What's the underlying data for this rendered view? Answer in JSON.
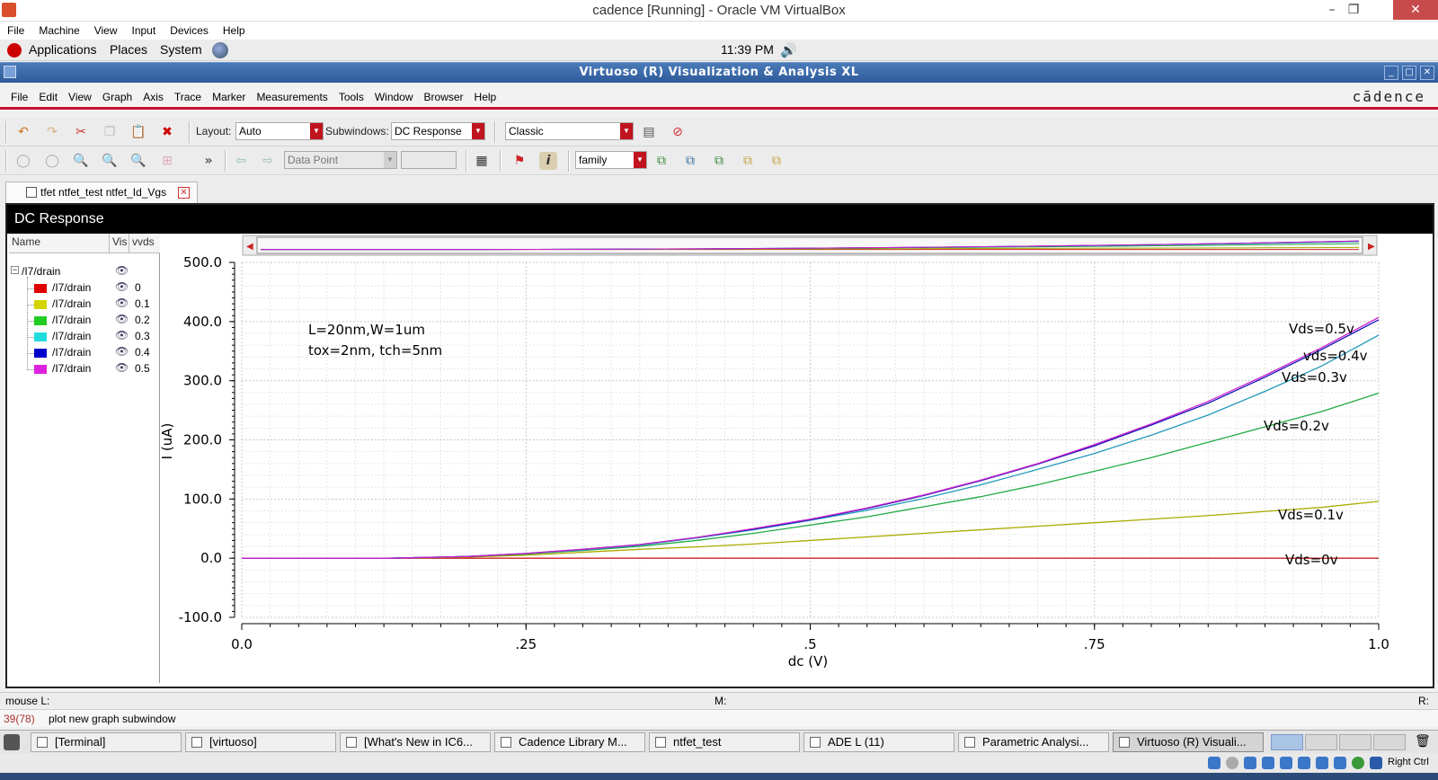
{
  "host_window": {
    "title": "cadence [Running] - Oracle VM VirtualBox",
    "menu": [
      "File",
      "Machine",
      "View",
      "Input",
      "Devices",
      "Help"
    ],
    "controls": [
      "–",
      "❐",
      "✕"
    ]
  },
  "gnome_panel": {
    "items": [
      "Applications",
      "Places",
      "System"
    ],
    "clock": "11:39 PM"
  },
  "app_window": {
    "title": "Virtuoso (R) Visualization & Analysis XL",
    "menu": [
      "File",
      "Edit",
      "View",
      "Graph",
      "Axis",
      "Trace",
      "Marker",
      "Measurements",
      "Tools",
      "Window",
      "Browser",
      "Help"
    ],
    "brand": "cādence",
    "controls": [
      "_",
      "□",
      "✕"
    ]
  },
  "toolbar1": {
    "layout_label": "Layout:",
    "layout_value": "Auto",
    "subwindows_label": "Subwindows:",
    "subwindows_value": "DC Response",
    "style_value": "Classic"
  },
  "toolbar2": {
    "more": "»",
    "data_point": "Data Point",
    "family_value": "family"
  },
  "tab": {
    "label": "tfet ntfet_test ntfet_Id_Vgs"
  },
  "subwindow": {
    "title": "DC Response"
  },
  "legend": {
    "headers": [
      "Name",
      "Vis",
      "vvds"
    ],
    "group": "/I7/drain",
    "rows": [
      {
        "name": "/I7/drain",
        "value": "0",
        "color": "#e00000"
      },
      {
        "name": "/I7/drain",
        "value": "0.1",
        "color": "#d4d400"
      },
      {
        "name": "/I7/drain",
        "value": "0.2",
        "color": "#22cc22"
      },
      {
        "name": "/I7/drain",
        "value": "0.3",
        "color": "#22dddd"
      },
      {
        "name": "/I7/drain",
        "value": "0.4",
        "color": "#0000cc"
      },
      {
        "name": "/I7/drain",
        "value": "0.5",
        "color": "#dd22dd"
      }
    ]
  },
  "chart_data": {
    "type": "line",
    "title": "",
    "xlabel": "dc (V)",
    "ylabel": "I (uA)",
    "xlim": [
      0,
      1.0
    ],
    "ylim": [
      -100,
      500
    ],
    "x_ticks": [
      "0.0",
      ".25",
      ".5",
      ".75",
      "1.0"
    ],
    "y_ticks": [
      "500.0",
      "400.0",
      "300.0",
      "200.0",
      "100.0",
      "0.0",
      "-100.0"
    ],
    "grid": true,
    "annotations": [
      "L=20nm,W=1um",
      "tox=2nm, tch=5nm"
    ],
    "curve_labels": [
      "Vds=0.5v",
      "vds=0.4v",
      "Vds=0.3v",
      "Vds=0.2v",
      "Vds=0.1v",
      "Vds=0v"
    ],
    "x": [
      0,
      0.1,
      0.13,
      0.2,
      0.25,
      0.3,
      0.35,
      0.4,
      0.45,
      0.5,
      0.55,
      0.6,
      0.65,
      0.7,
      0.75,
      0.8,
      0.85,
      0.9,
      0.95,
      1.0
    ],
    "series": [
      {
        "color": "#cc2222",
        "values": [
          0,
          0,
          0,
          0,
          0,
          0,
          0,
          0,
          0,
          0,
          0,
          0,
          0,
          0,
          0,
          0,
          0,
          0,
          0,
          0
        ]
      },
      {
        "color": "#aaaa00",
        "values": [
          0,
          0,
          0,
          2,
          5,
          10,
          15,
          19,
          24,
          30,
          36,
          42,
          48,
          54,
          60,
          66,
          72,
          79,
          86,
          96
        ]
      },
      {
        "color": "#22aa44",
        "values": [
          0,
          0,
          0,
          3,
          7,
          13,
          20,
          30,
          42,
          56,
          70,
          87,
          104,
          124,
          147,
          170,
          196,
          222,
          248,
          279
        ]
      },
      {
        "color": "#2299bb",
        "values": [
          0,
          0,
          0,
          3,
          8,
          14,
          22,
          34,
          48,
          64,
          81,
          101,
          124,
          150,
          177,
          208,
          242,
          282,
          325,
          377
        ]
      },
      {
        "color": "#1111bb",
        "values": [
          0,
          0,
          0,
          3,
          8,
          15,
          23,
          35,
          49,
          65,
          84,
          106,
          131,
          159,
          190,
          225,
          262,
          306,
          353,
          403
        ]
      },
      {
        "color": "#cc22cc",
        "values": [
          0,
          0,
          0,
          3,
          8,
          15,
          23,
          35,
          50,
          66,
          85,
          107,
          132,
          160,
          192,
          227,
          265,
          309,
          356,
          407
        ]
      }
    ]
  },
  "status": {
    "mouse_l": "mouse L:",
    "m": "M:",
    "r": "R:",
    "line_no": "39(78)",
    "message": "plot new graph subwindow"
  },
  "taskbar": {
    "items": [
      "[Terminal]",
      "[virtuoso]",
      "[What's New in IC6...",
      "Cadence Library M...",
      "ntfet_test",
      "ADE L (11)",
      "Parametric Analysi...",
      "Virtuoso (R) Visuali..."
    ],
    "tray_label": "Right Ctrl"
  }
}
